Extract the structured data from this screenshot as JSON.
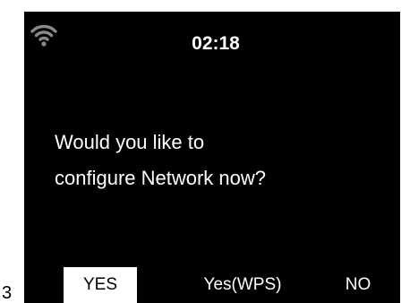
{
  "figure_number": "3",
  "status_bar": {
    "wifi_icon": "wifi-icon",
    "time": "02:18"
  },
  "dialog": {
    "line1": "Would you like to",
    "line2": "configure Network now?"
  },
  "options": {
    "yes": "YES",
    "yes_wps": "Yes(WPS)",
    "no": "NO",
    "selected": "YES"
  },
  "colors": {
    "screen_background": "#000000",
    "text": "#ffffff",
    "selection_background": "#ffffff",
    "selection_text": "#000000"
  }
}
